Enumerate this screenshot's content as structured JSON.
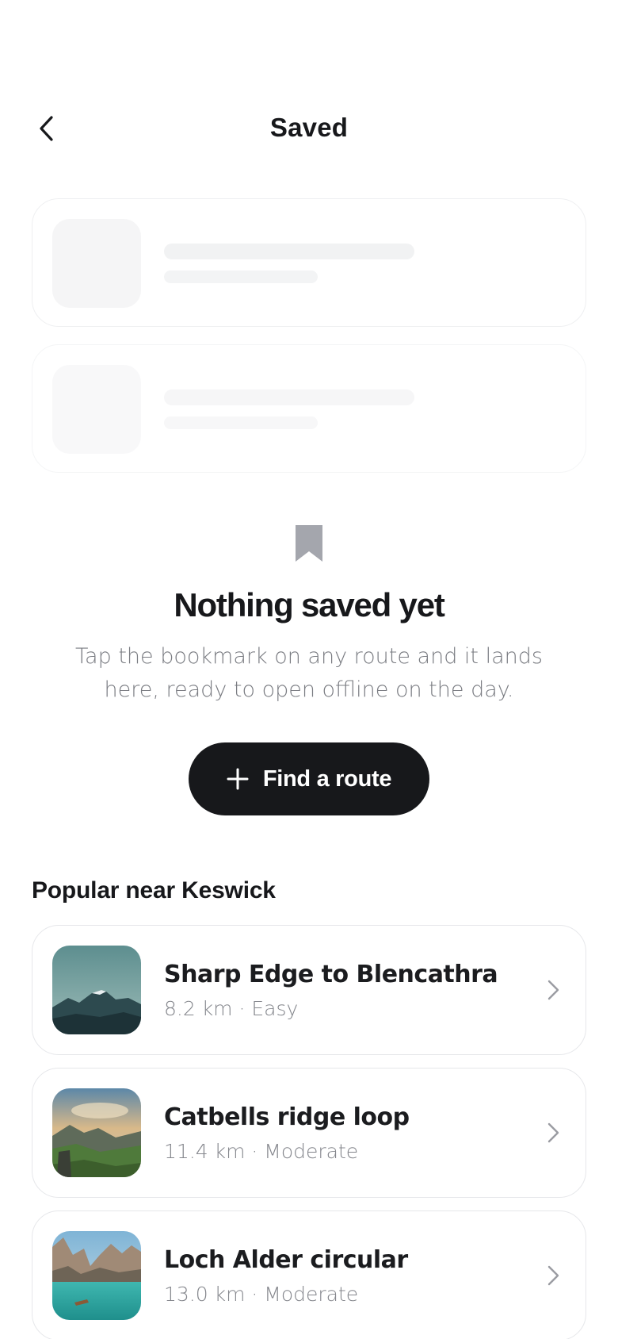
{
  "header": {
    "title": "Saved",
    "back_icon": "chevron-left-icon"
  },
  "empty_state": {
    "icon": "bookmark-icon",
    "title": "Nothing saved yet",
    "description": "Tap the bookmark on any route and it lands here, ready to open offline on the day.",
    "cta_icon": "plus-icon",
    "cta_label": "Find a route"
  },
  "popular": {
    "title": "Popular near Keswick",
    "routes": [
      {
        "name": "Sharp Edge to Blencathra",
        "meta": "8.2 km · Easy"
      },
      {
        "name": "Catbells ridge loop",
        "meta": "11.4 km · Moderate"
      },
      {
        "name": "Loch Alder circular",
        "meta": "13.0 km · Moderate"
      }
    ]
  },
  "colors": {
    "primary": "#17181b",
    "muted_text": "#7a7c82",
    "bookmark": "#a4a6ad",
    "card_border": "#e6e7ea"
  }
}
